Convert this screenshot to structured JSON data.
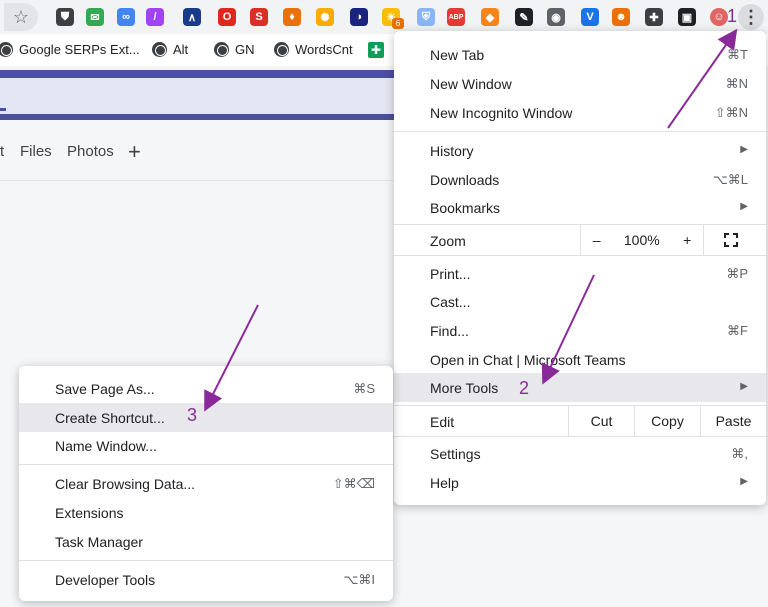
{
  "toolbar": {
    "extensions": [
      {
        "icon": "shield-ext-icon",
        "color": "#3c4043",
        "glyph": "⛊"
      },
      {
        "icon": "inbox-ext-icon",
        "color": "#34a853",
        "glyph": "✉"
      },
      {
        "icon": "link-ext-icon",
        "color": "#4285f4",
        "glyph": "∞"
      },
      {
        "icon": "pen-ext-icon",
        "color": "#a142f4",
        "glyph": "/"
      },
      {
        "icon": "chart-ext-icon",
        "color": "#1a3a8a",
        "glyph": "∧"
      },
      {
        "icon": "opera-ext-icon",
        "color": "#e0271b",
        "glyph": "O"
      },
      {
        "icon": "seo-ext-icon",
        "color": "#d93025",
        "glyph": "S"
      },
      {
        "icon": "fire-ext-icon",
        "color": "#e8710a",
        "glyph": "♦"
      },
      {
        "icon": "gear-ext-icon",
        "color": "#f9ab00",
        "glyph": "✺"
      },
      {
        "icon": "half-moon-ext-icon",
        "color": "#1a237e",
        "glyph": "◑"
      },
      {
        "icon": "bulb-ext-icon",
        "color": "#fbbc04",
        "glyph": "☀"
      },
      {
        "icon": "badge-shield-ext-icon",
        "color": "#8ab4f8",
        "glyph": "⛨"
      },
      {
        "icon": "adblock-ext-icon",
        "color": "#e53935",
        "glyph": "ABP"
      },
      {
        "icon": "metamask-ext-icon",
        "color": "#f6851b",
        "glyph": "◆"
      },
      {
        "icon": "eyedropper-ext-icon",
        "color": "#202124",
        "glyph": "✎"
      },
      {
        "icon": "camera-ext-icon",
        "color": "#5f6368",
        "glyph": "◉"
      },
      {
        "icon": "vee-ext-icon",
        "color": "#1a73e8",
        "glyph": "V"
      },
      {
        "icon": "robot-ext-icon",
        "color": "#e8710a",
        "glyph": "☻"
      },
      {
        "icon": "puzzle-ext-icon",
        "color": "#3c4043",
        "glyph": "✚"
      },
      {
        "icon": "sidepanel-ext-icon",
        "color": "#202124",
        "glyph": "▣"
      },
      {
        "icon": "profile-avatar-icon",
        "color": "#e06666",
        "glyph": "☺"
      }
    ],
    "badge_count": "6",
    "kebab_glyph": "⋮"
  },
  "bookmarks": {
    "items": [
      {
        "label": "Google SERPs Ext..."
      },
      {
        "label": "Alt"
      },
      {
        "label": "GN"
      },
      {
        "label": "WordsCnt"
      }
    ]
  },
  "page": {
    "tabs": [
      "t",
      "Files",
      "Photos",
      "+"
    ]
  },
  "menu": {
    "new_tab": {
      "label": "New Tab",
      "shortcut": "⌘T"
    },
    "new_window": {
      "label": "New Window",
      "shortcut": "⌘N"
    },
    "new_incognito": {
      "label": "New Incognito Window",
      "shortcut": "⇧⌘N"
    },
    "history": {
      "label": "History"
    },
    "downloads": {
      "label": "Downloads",
      "shortcut": "⌥⌘L"
    },
    "bookmarks": {
      "label": "Bookmarks"
    },
    "zoom": {
      "label": "Zoom",
      "minus": "–",
      "value": "100%",
      "plus": "+"
    },
    "print": {
      "label": "Print...",
      "shortcut": "⌘P"
    },
    "cast": {
      "label": "Cast..."
    },
    "find": {
      "label": "Find...",
      "shortcut": "⌘F"
    },
    "open_in_chat": {
      "label": "Open in Chat | Microsoft Teams"
    },
    "more_tools": {
      "label": "More Tools"
    },
    "edit": {
      "label": "Edit",
      "cut": "Cut",
      "copy": "Copy",
      "paste": "Paste"
    },
    "settings": {
      "label": "Settings",
      "shortcut": "⌘,"
    },
    "help": {
      "label": "Help"
    }
  },
  "submenu": {
    "save_page": {
      "label": "Save Page As...",
      "shortcut": "⌘S"
    },
    "create_shortcut": {
      "label": "Create Shortcut..."
    },
    "name_window": {
      "label": "Name Window..."
    },
    "clear_data": {
      "label": "Clear Browsing Data...",
      "shortcut": "⇧⌘⌫"
    },
    "extensions": {
      "label": "Extensions"
    },
    "task_manager": {
      "label": "Task Manager"
    },
    "dev_tools": {
      "label": "Developer Tools",
      "shortcut": "⌥⌘I"
    }
  },
  "annotations": {
    "step1": "1",
    "step2": "2",
    "step3": "3",
    "color": "#8a2a9a"
  }
}
